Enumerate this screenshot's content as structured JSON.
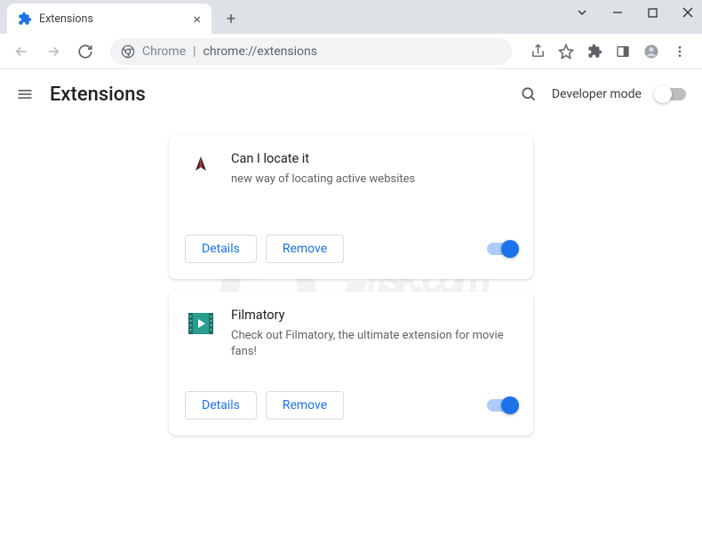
{
  "window": {
    "tab_title": "Extensions"
  },
  "omnibox": {
    "prefix": "Chrome",
    "url": "chrome://extensions"
  },
  "page": {
    "title": "Extensions",
    "dev_mode_label": "Developer mode"
  },
  "buttons": {
    "details": "Details",
    "remove": "Remove"
  },
  "extensions": [
    {
      "name": "Can I locate it",
      "description": "new way of locating active websites",
      "enabled": true,
      "icon": "bird-logo"
    },
    {
      "name": "Filmatory",
      "description": "Check out Filmatory, the ultimate extension for movie fans!",
      "enabled": true,
      "icon": "film-logo"
    }
  ],
  "watermark": "PCrisk.com"
}
